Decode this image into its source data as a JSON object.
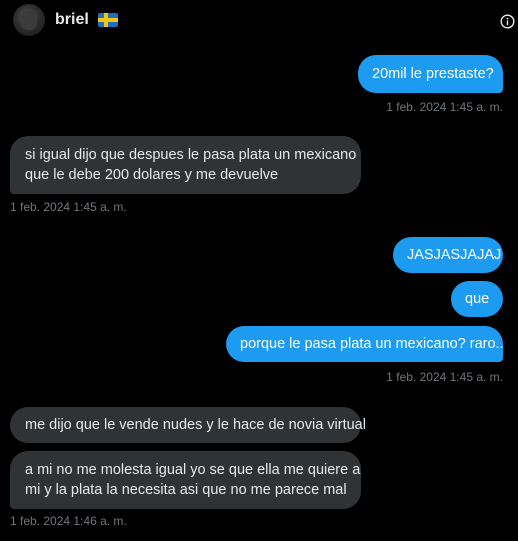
{
  "header": {
    "username": "briel",
    "flag_icon": "sweden-flag-icon",
    "info_icon": "info-icon"
  },
  "colors": {
    "background": "#000000",
    "outgoing_bubble": "#1d9bf0",
    "incoming_bubble": "#2f3336",
    "timestamp": "#71767b"
  },
  "messages": [
    {
      "direction": "outgoing",
      "text": "20mil le prestaste?"
    },
    {
      "direction": "incoming",
      "line1": "si igual dijo que despues le pasa plata un mexicano",
      "line2": "que le debe 200 dolares y me devuelve"
    },
    {
      "direction": "outgoing",
      "text": "JASJASJAJAJ"
    },
    {
      "direction": "outgoing",
      "text": "que"
    },
    {
      "direction": "outgoing",
      "text": "porque le pasa plata un mexicano? raro.."
    },
    {
      "direction": "incoming",
      "text": "me dijo que le vende nudes y le hace de novia virtual"
    },
    {
      "direction": "incoming",
      "line1": "a mi no me molesta igual yo se que ella me quiere a",
      "line2": "mi y la plata la necesita asi que no me parece mal"
    }
  ],
  "timestamps": [
    "1 feb. 2024 1:45 a. m.",
    "1 feb. 2024 1:45 a. m.",
    "1 feb. 2024 1:45 a. m.",
    "1 feb. 2024 1:46 a. m."
  ]
}
